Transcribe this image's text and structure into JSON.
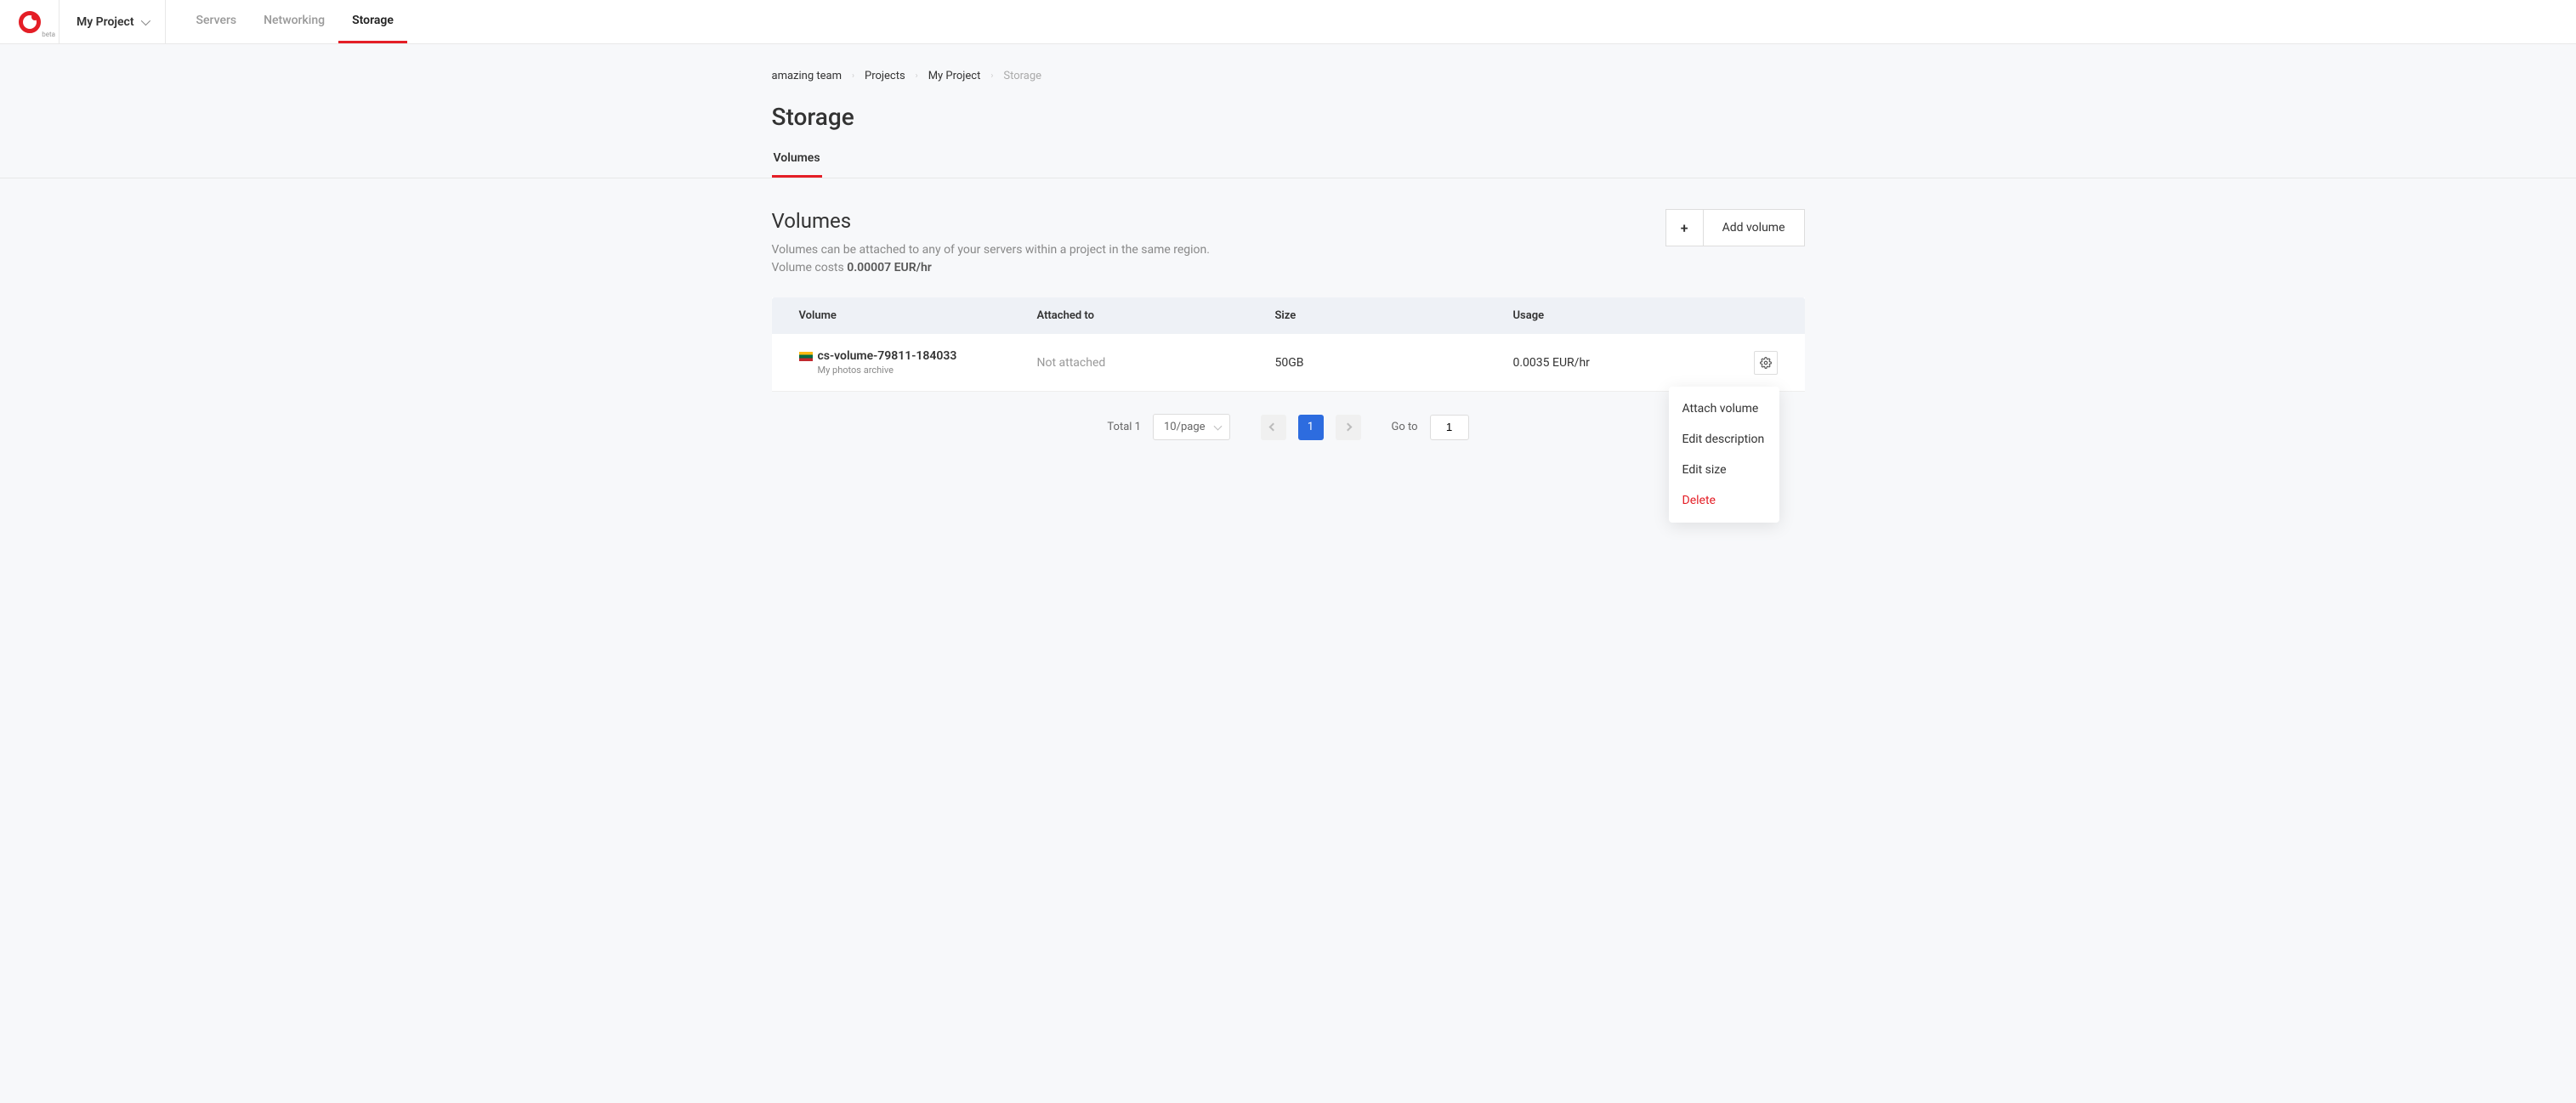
{
  "header": {
    "beta_label": "beta",
    "project_name": "My Project",
    "nav": [
      {
        "label": "Servers",
        "active": false
      },
      {
        "label": "Networking",
        "active": false
      },
      {
        "label": "Storage",
        "active": true
      }
    ]
  },
  "breadcrumb": [
    {
      "label": "amazing team",
      "muted": false
    },
    {
      "label": "Projects",
      "muted": false
    },
    {
      "label": "My Project",
      "muted": false
    },
    {
      "label": "Storage",
      "muted": true
    }
  ],
  "page_title": "Storage",
  "subtabs": [
    {
      "label": "Volumes",
      "active": true
    }
  ],
  "section": {
    "title": "Volumes",
    "description_line1": "Volumes can be attached to any of your servers within a project in the same region.",
    "description_line2_prefix": "Volume costs ",
    "description_line2_bold": "0.00007 EUR/hr",
    "add_button_label": "Add volume"
  },
  "table": {
    "headers": {
      "volume": "Volume",
      "attached": "Attached to",
      "size": "Size",
      "usage": "Usage"
    },
    "rows": [
      {
        "flag": "lt",
        "name": "cs-volume-79811-184033",
        "description": "My photos archive",
        "attached": "Not attached",
        "size": "50GB",
        "usage": "0.0035 EUR/hr"
      }
    ]
  },
  "row_menu": [
    {
      "label": "Attach volume",
      "danger": false
    },
    {
      "label": "Edit description",
      "danger": false
    },
    {
      "label": "Edit size",
      "danger": false
    },
    {
      "label": "Delete",
      "danger": true
    }
  ],
  "pagination": {
    "total_label": "Total 1",
    "page_size_label": "10/page",
    "current_page": "1",
    "goto_label": "Go to",
    "goto_value": "1"
  }
}
